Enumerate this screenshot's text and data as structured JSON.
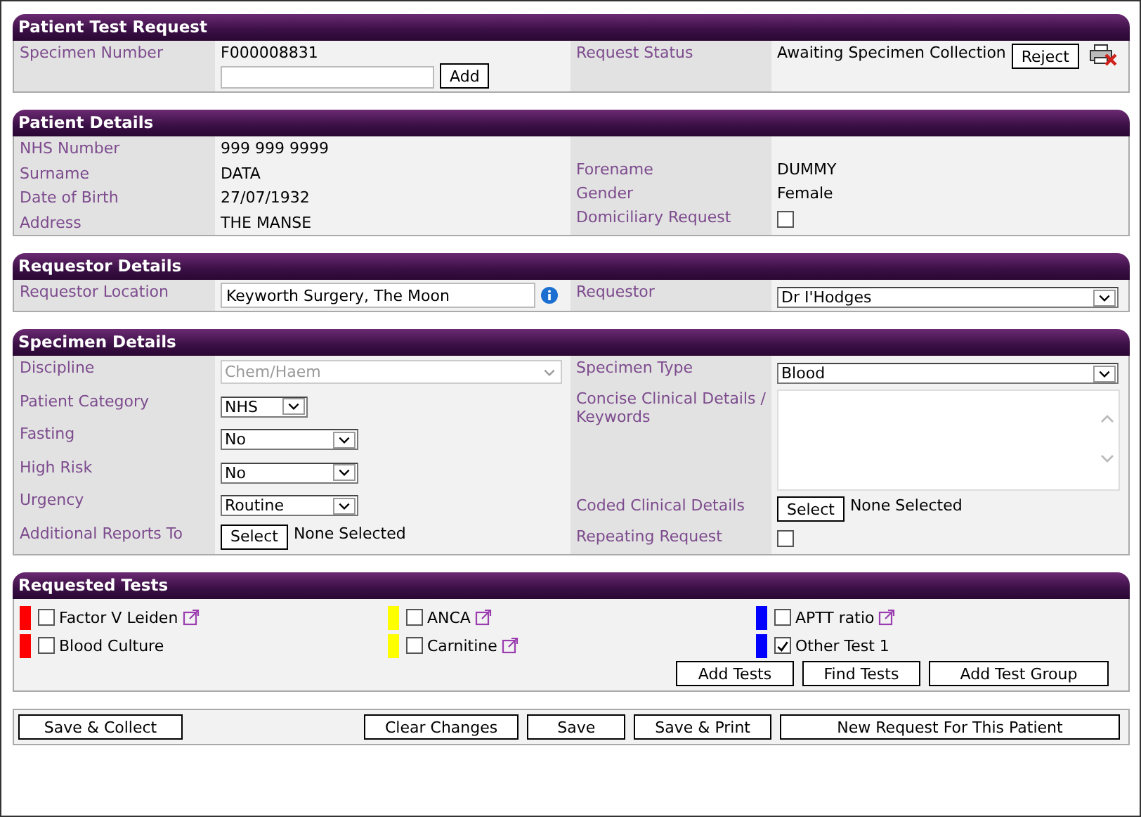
{
  "sections": [
    {
      "title": "Patient Test Request",
      "left": [
        {
          "label": "Specimen Number",
          "kind": "text_add",
          "value": "F000008831",
          "button": "Add"
        }
      ],
      "right": [
        {
          "label": "Request Status",
          "kind": "status",
          "value": "Awaiting Specimen Collection",
          "button": "Reject"
        }
      ]
    },
    {
      "title": "Patient Details",
      "left": [
        {
          "label": "NHS Number",
          "kind": "text",
          "value": "999 999 9999"
        },
        {
          "label": "Surname",
          "kind": "text",
          "value": "DATA"
        },
        {
          "label": "Date of Birth",
          "kind": "text",
          "value": "27/07/1932"
        },
        {
          "label": "Address",
          "kind": "text",
          "value": "THE MANSE"
        }
      ],
      "right": [
        {
          "kind": "blank"
        },
        {
          "label": "Forename",
          "kind": "text",
          "value": "DUMMY"
        },
        {
          "label": "Gender",
          "kind": "text",
          "value": "Female"
        },
        {
          "label": "Domiciliary Request",
          "kind": "checkbox",
          "checked": false
        }
      ]
    },
    {
      "title": "Requestor Details",
      "left": [
        {
          "label": "Requestor Location",
          "kind": "input_info",
          "value": "Keyworth Surgery, The Moon"
        }
      ],
      "right": [
        {
          "label": "Requestor",
          "kind": "select",
          "value": "Dr I'Hodges",
          "disabled": false
        }
      ]
    },
    {
      "title": "Specimen Details",
      "left": [
        {
          "label": "Discipline",
          "kind": "select",
          "value": "Chem/Haem",
          "disabled": true
        },
        {
          "label": "Patient Category",
          "kind": "tiny_select",
          "value": "NHS",
          "disabled": false
        },
        {
          "label": "Fasting",
          "kind": "short_select",
          "value": "No",
          "disabled": false
        },
        {
          "label": "High Risk",
          "kind": "short_select",
          "value": "No",
          "disabled": false
        },
        {
          "label": "Urgency",
          "kind": "short_select",
          "value": "Routine",
          "disabled": false
        },
        {
          "label": "Additional Reports To",
          "kind": "select_button",
          "button": "Select",
          "value": "None Selected"
        }
      ],
      "right": [
        {
          "label": "Specimen Type",
          "kind": "select",
          "value": "Blood",
          "disabled": false
        },
        {
          "label": "Concise Clinical Details / Keywords",
          "kind": "textarea"
        },
        {
          "label": "Coded Clinical Details",
          "kind": "select_button",
          "button": "Select",
          "value": "None Selected"
        },
        {
          "label": "Repeating Request",
          "kind": "checkbox",
          "checked": false
        }
      ]
    }
  ],
  "requested_tests": {
    "title": "Requested Tests",
    "tests": [
      {
        "name": "Factor V Leiden",
        "color": "#ff0000",
        "checked": false,
        "link": true
      },
      {
        "name": "ANCA",
        "color": "#ffff00",
        "checked": false,
        "link": true
      },
      {
        "name": "APTT ratio",
        "color": "#0000ff",
        "checked": false,
        "link": true
      },
      {
        "name": "Blood Culture",
        "color": "#ff0000",
        "checked": false,
        "link": false
      },
      {
        "name": "Carnitine",
        "color": "#ffff00",
        "checked": false,
        "link": true
      },
      {
        "name": "Other Test 1",
        "color": "#0000ff",
        "checked": true,
        "link": false
      }
    ],
    "buttons": [
      "Add Tests",
      "Find Tests",
      "Add Test Group"
    ]
  },
  "footer": {
    "left_buttons": [
      "Save & Collect"
    ],
    "right_buttons": [
      "Clear Changes",
      "Save",
      "Save & Print",
      "New Request For This Patient"
    ]
  }
}
